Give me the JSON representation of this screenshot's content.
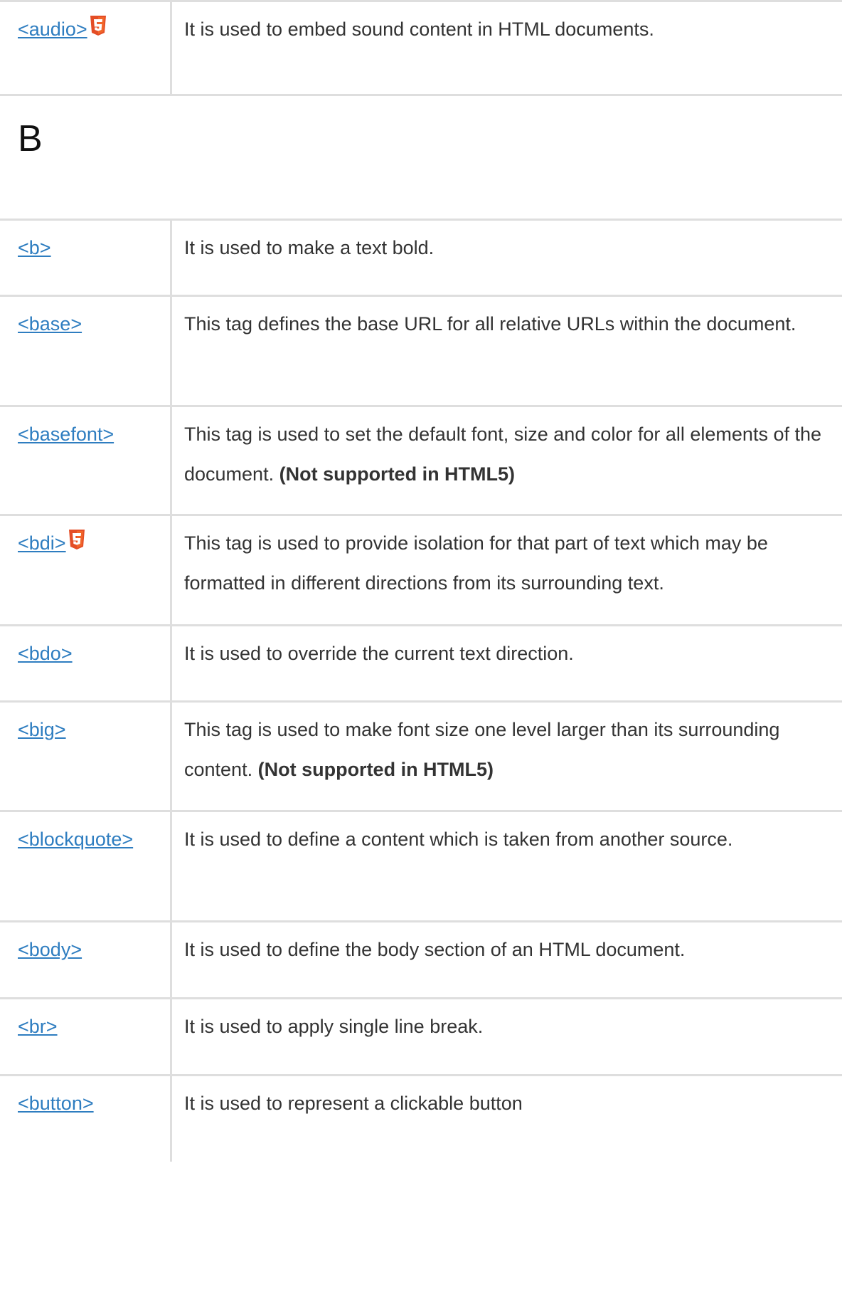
{
  "rows_a": [
    {
      "tag": "<audio>",
      "html5": true,
      "description": "It is used to embed sound content in HTML documents.",
      "note": ""
    }
  ],
  "section_b": {
    "letter": "B"
  },
  "rows_b": [
    {
      "tag": "<b>",
      "html5": false,
      "description": "It is used to make a text bold.",
      "note": ""
    },
    {
      "tag": "<base>",
      "html5": false,
      "description": "This tag defines the base URL for all relative URLs within the document.",
      "note": ""
    },
    {
      "tag": "<basefont>",
      "html5": false,
      "description": "This tag is used to set the default font, size and color for all elements of the document.",
      "note": "(Not supported in HTML5)"
    },
    {
      "tag": "<bdi>",
      "html5": true,
      "description": "This tag is used to provide isolation for that part of text which may be formatted in different directions from its surrounding text.",
      "note": ""
    },
    {
      "tag": "<bdo>",
      "html5": false,
      "description": "It is used to override the current text direction.",
      "note": ""
    },
    {
      "tag": "<big>",
      "html5": false,
      "description": "This tag is used to make font size one level larger than its surrounding content.",
      "note": "(Not supported in HTML5)"
    },
    {
      "tag": "<blockquote>",
      "html5": false,
      "description": "It is used to define a content which is taken from another source.",
      "note": ""
    },
    {
      "tag": "<body>",
      "html5": false,
      "description": "It is used to define the body section of an HTML document.",
      "note": ""
    },
    {
      "tag": "<br>",
      "html5": false,
      "description": "It is used to apply single line break.",
      "note": ""
    },
    {
      "tag": "<button>",
      "html5": false,
      "description": "It is used to represent a clickable button",
      "note": ""
    }
  ],
  "colors": {
    "link": "#2e7dc0",
    "border": "#dedede",
    "html5_badge": "#e44d26"
  },
  "icons": {
    "html5": "html5-icon"
  }
}
